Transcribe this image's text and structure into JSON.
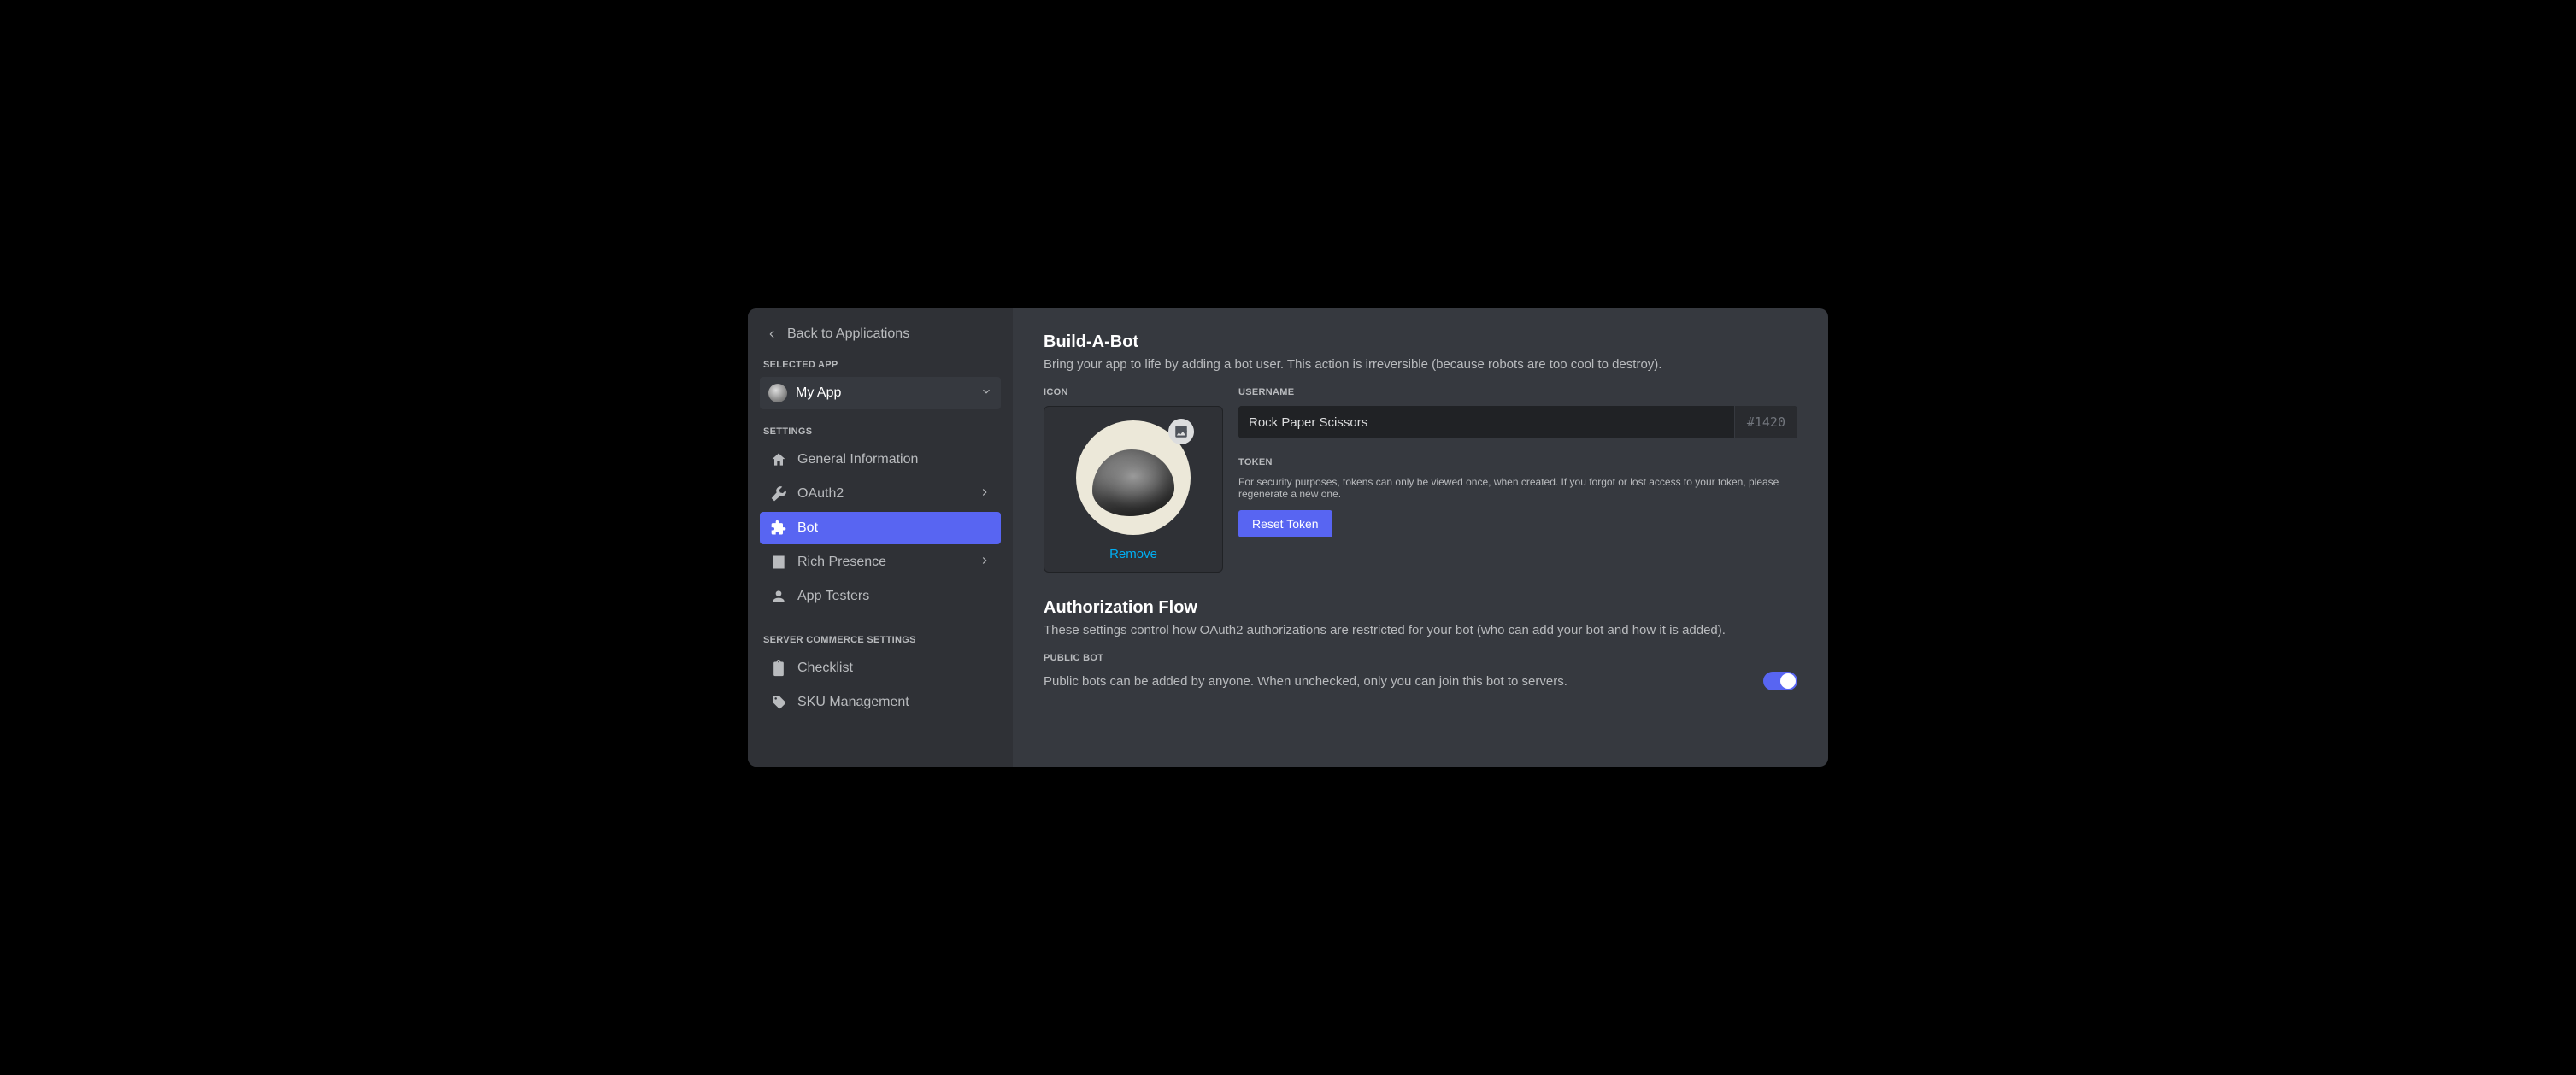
{
  "back_label": "Back to Applications",
  "selected_app_heading": "SELECTED APP",
  "selected_app_name": "My App",
  "settings_heading": "SETTINGS",
  "nav": {
    "general": "General Information",
    "oauth2": "OAuth2",
    "bot": "Bot",
    "rich_presence": "Rich Presence",
    "app_testers": "App Testers"
  },
  "commerce_heading": "SERVER COMMERCE SETTINGS",
  "commerce": {
    "checklist": "Checklist",
    "sku": "SKU Management"
  },
  "build": {
    "title": "Build-A-Bot",
    "desc": "Bring your app to life by adding a bot user. This action is irreversible (because robots are too cool to destroy).",
    "icon_label": "ICON",
    "remove": "Remove",
    "username_label": "USERNAME",
    "username_value": "Rock Paper Scissors",
    "discriminator": "#1420",
    "token_label": "TOKEN",
    "token_help": "For security purposes, tokens can only be viewed once, when created. If you forgot or lost access to your token, please regenerate a new one.",
    "reset_token": "Reset Token"
  },
  "auth": {
    "title": "Authorization Flow",
    "desc": "These settings control how OAuth2 authorizations are restricted for your bot (who can add your bot and how it is added).",
    "public_bot_label": "PUBLIC BOT",
    "public_bot_desc": "Public bots can be added by anyone. When unchecked, only you can join this bot to servers."
  }
}
